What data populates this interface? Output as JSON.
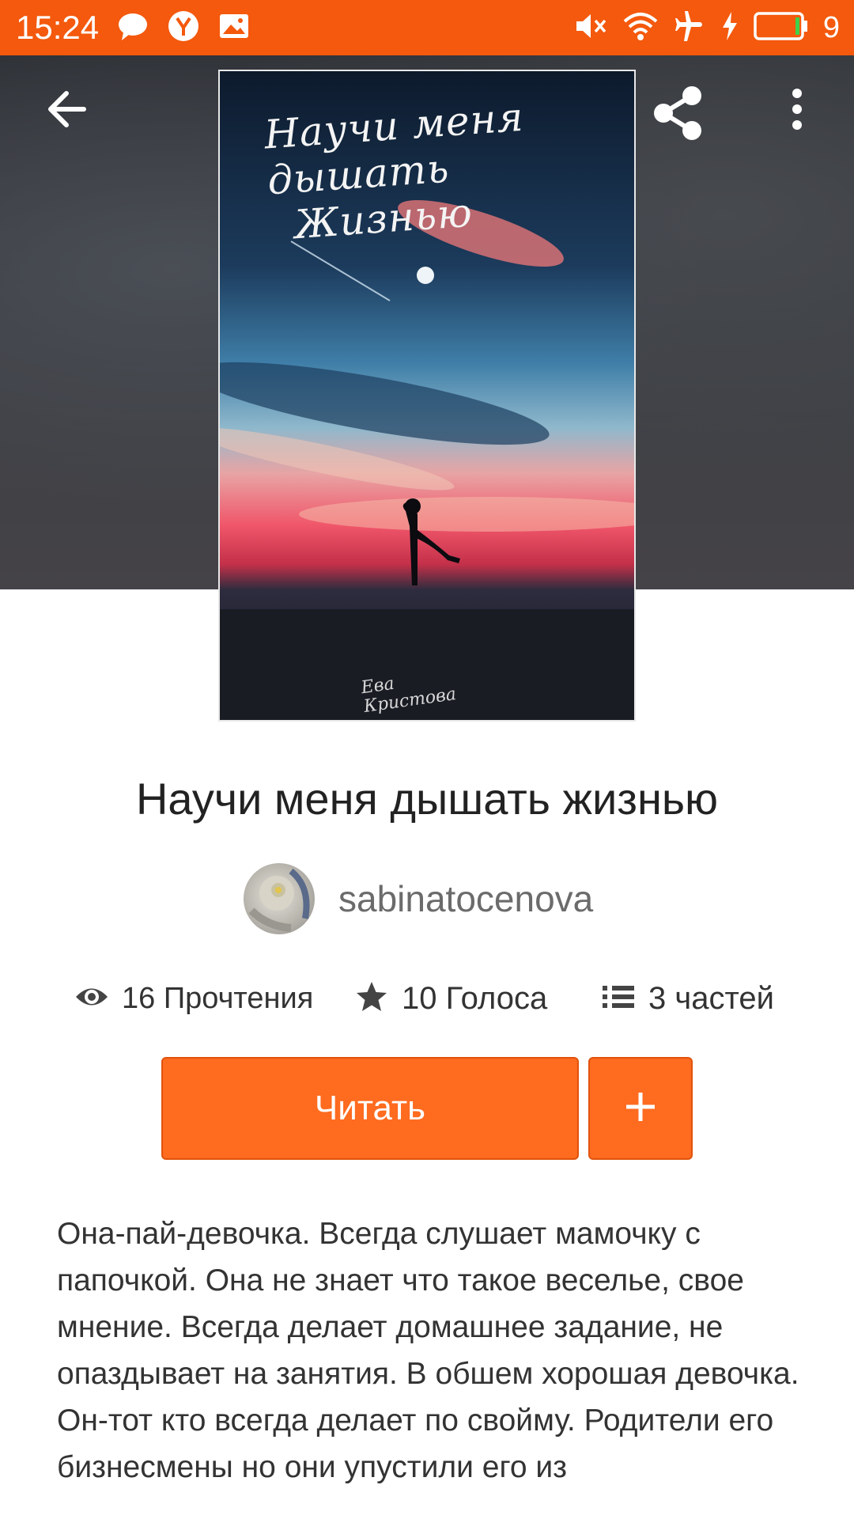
{
  "status_bar": {
    "time": "15:24",
    "battery_level": "9",
    "icons": [
      "chat-icon",
      "yandex-icon",
      "gallery-icon",
      "mute-icon",
      "wifi-icon",
      "airplane-icon",
      "charging-icon",
      "battery-icon"
    ]
  },
  "toolbar": {
    "back_icon": "arrow-left-icon",
    "share_icon": "share-icon",
    "menu_icon": "more-vertical-icon"
  },
  "cover": {
    "title_lines": [
      "Научи меня",
      "дышать",
      "Жизнью"
    ],
    "author_lines": [
      "Ева",
      "Кристова"
    ]
  },
  "book": {
    "title": "Научи меня дышать жизнью",
    "author": "sabinatocenova"
  },
  "stats": {
    "reads": "16 Прочтения",
    "votes": "10 Голоса",
    "parts": "3 частей"
  },
  "actions": {
    "read_label": "Читать",
    "add_label": "+"
  },
  "description": "Она-пай-девочка. Всегда слушает мамочку с папочкой. Она не знает что такое веселье, свое мнение. Всегда делает домашнее задание, не опаздывает на занятия. В обшем хорошая девочка.\nОн-тот кто всегда делает по свойму. Родители его бизнесмены но они упустили его из",
  "colors": {
    "accent": "#ff6b1f",
    "status_bar": "#f4590d",
    "text": "#333333"
  }
}
